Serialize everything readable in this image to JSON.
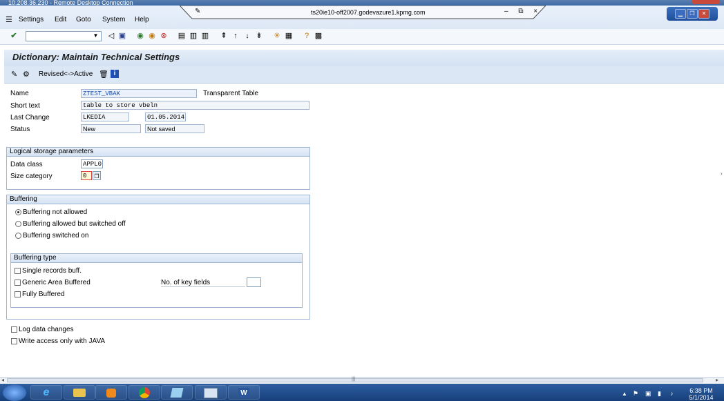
{
  "window": {
    "title": "10.208.36.230 - Remote Desktop Connection",
    "connection_host": "ts20ie10-off2007.godevazure1.kpmg.com",
    "connection_controls": "– ⧉ ×"
  },
  "menu": {
    "items": [
      {
        "label": "Settings"
      },
      {
        "label": "Edit"
      },
      {
        "label": "Goto"
      },
      {
        "label": "System"
      },
      {
        "label": "Help"
      }
    ]
  },
  "page": {
    "title": "Dictionary: Maintain Technical Settings",
    "revised_active_label": "Revised<->Active"
  },
  "header_fields": {
    "name_label": "Name",
    "name_value": "ZTEST_VBAK",
    "table_type": "Transparent Table",
    "short_text_label": "Short text",
    "short_text_value": "table to store vbeln",
    "last_change_label": "Last Change",
    "last_change_user": "LKEDIA",
    "last_change_date": "01.05.2014",
    "status_label": "Status",
    "status_value": "New",
    "status_saved": "Not saved"
  },
  "logical_storage": {
    "title": "Logical storage parameters",
    "data_class_label": "Data class",
    "data_class_value": "APPL0",
    "size_category_label": "Size category",
    "size_category_value": "0"
  },
  "buffering": {
    "title": "Buffering",
    "options": [
      {
        "label": "Buffering not allowed",
        "selected": true
      },
      {
        "label": "Buffering allowed but switched off",
        "selected": false
      },
      {
        "label": "Buffering switched on",
        "selected": false
      }
    ],
    "type_title": "Buffering type",
    "types": [
      {
        "label": "Single records buff."
      },
      {
        "label": "Generic Area Buffered"
      },
      {
        "label": "Fully Buffered"
      }
    ],
    "key_fields_label": "No. of key fields",
    "key_fields_value": ""
  },
  "options": {
    "log_data_changes": "Log data changes",
    "write_access_java": "Write access only with JAVA"
  },
  "taskbar": {
    "time": "6:38 PM",
    "date": "5/1/2014"
  }
}
